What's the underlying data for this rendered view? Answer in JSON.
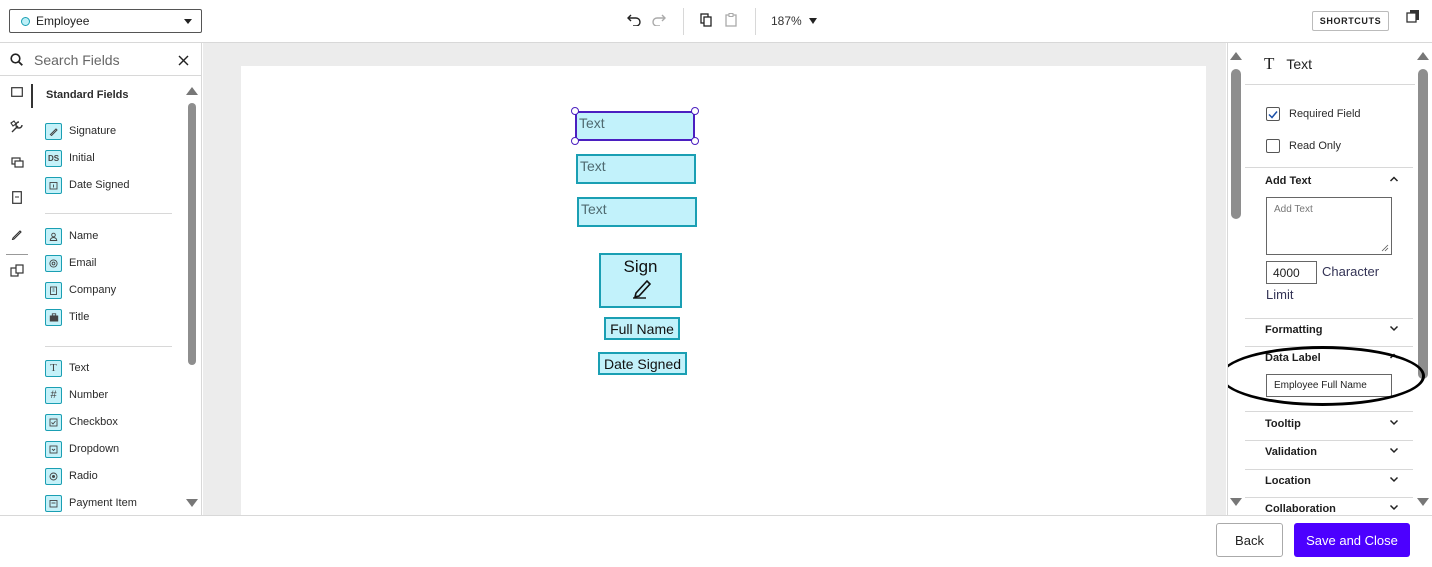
{
  "topbar": {
    "recipient": "Employee",
    "zoom": "187%",
    "shortcuts_label": "SHORTCUTS"
  },
  "left_panel": {
    "search_placeholder": "Search Fields",
    "section_title": "Standard Fields",
    "groups": [
      [
        {
          "label": "Signature",
          "icon": "pen-icon"
        },
        {
          "label": "Initial",
          "icon": "initials-icon",
          "glyph": "DS"
        },
        {
          "label": "Date Signed",
          "icon": "calendar-icon"
        }
      ],
      [
        {
          "label": "Name",
          "icon": "person-icon"
        },
        {
          "label": "Email",
          "icon": "at-icon"
        },
        {
          "label": "Company",
          "icon": "building-icon"
        },
        {
          "label": "Title",
          "icon": "briefcase-icon"
        }
      ],
      [
        {
          "label": "Text",
          "icon": "text-icon",
          "glyph": "T"
        },
        {
          "label": "Number",
          "icon": "hash-icon",
          "glyph": "#"
        },
        {
          "label": "Checkbox",
          "icon": "checkbox-icon"
        },
        {
          "label": "Dropdown",
          "icon": "dropdown-icon"
        },
        {
          "label": "Radio",
          "icon": "radio-icon"
        },
        {
          "label": "Payment Item",
          "icon": "payment-icon"
        }
      ]
    ]
  },
  "canvas": {
    "tags": {
      "text_1": "Text",
      "text_2": "Text",
      "text_3": "Text",
      "sign": "Sign",
      "full_name": "Full Name",
      "date_signed": "Date Signed"
    }
  },
  "right_panel": {
    "field_type": "Text",
    "required_label": "Required Field",
    "required_checked": true,
    "readonly_label": "Read Only",
    "readonly_checked": false,
    "add_text": {
      "title": "Add Text",
      "placeholder": "Add Text",
      "char_limit": "4000",
      "char_limit_label_1": "Character",
      "char_limit_label_2": "Limit"
    },
    "sections": {
      "formatting": "Formatting",
      "data_label": "Data Label",
      "tooltip": "Tooltip",
      "validation": "Validation",
      "location": "Location",
      "collaboration": "Collaboration"
    },
    "data_label_value": "Employee Full Name"
  },
  "bottombar": {
    "back_label": "Back",
    "save_label": "Save and Close"
  },
  "colors": {
    "accent": "#4c00ff",
    "tag_fill": "#c2f2fb",
    "tag_border": "#1a9fb3",
    "selected_border": "#4b1fc0"
  }
}
